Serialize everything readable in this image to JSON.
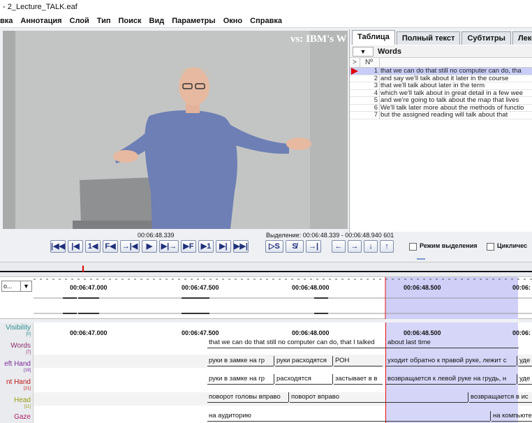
{
  "window": {
    "title": "- 2_Lecture_TALK.eaf"
  },
  "menu": [
    "вка",
    "Аннотация",
    "Слой",
    "Тип",
    "Поиск",
    "Вид",
    "Параметры",
    "Окно",
    "Справка"
  ],
  "video": {
    "watermark": "vs: IBM's W"
  },
  "right_panel": {
    "tabs": [
      "Таблица",
      "Полный текст",
      "Субтитры",
      "Лексик"
    ],
    "tier_dropdown": "▼",
    "tier_name": "Words",
    "col_marker": ">",
    "col_number": "Nº",
    "rows": [
      {
        "num": "1",
        "text": "that we can do that still no computer can do, tha"
      },
      {
        "num": "2",
        "text": "and say we'll talk about it later in the course"
      },
      {
        "num": "3",
        "text": "that we'll talk about later in the term"
      },
      {
        "num": "4",
        "text": "which we'll talk about in great detail in a few wee"
      },
      {
        "num": "5",
        "text": "and we're going to talk about the map that lives"
      },
      {
        "num": "6",
        "text": "We'll talk later more about the methods of functio"
      },
      {
        "num": "7",
        "text": "but the assigned reading will talk about that"
      }
    ]
  },
  "controls": {
    "current_time": "00:06:48.339",
    "selection": "Выделение: 00:06:48.339 - 00:06:48.940  601",
    "buttons": [
      "|◀◀",
      "|◀",
      "1◀",
      "F◀",
      "→|◀",
      "▶",
      "▶|→",
      "▶F",
      "▶1",
      "▶|",
      "▶▶|",
      "▷S",
      "S̸",
      "→|",
      "←",
      "→",
      "↓",
      "↑"
    ],
    "selection_mode": "Режим выделения",
    "loop_mode": "Цикличес"
  },
  "waveform": {
    "dropdown": "о...",
    "dropdown_arrow": "▼",
    "times": [
      "00:06:47.000",
      "00:06:47.500",
      "00:06:48.000",
      "00:06:48.500",
      "00:06:"
    ]
  },
  "timeline": {
    "times": [
      "00:06:47.000",
      "00:06:47.500",
      "00:06:48.000",
      "00:06:48.500",
      "00:06:"
    ],
    "tiers": [
      {
        "name": "Visibility",
        "count": "[0]",
        "color": "#2a8f8f"
      },
      {
        "name": "Words",
        "count": "[7]",
        "color": "#8b2d6b"
      },
      {
        "name": "eft Hand",
        "count": "[19]",
        "color": "#7a2a9a"
      },
      {
        "name": "nt Hand",
        "count": "[21]",
        "color": "#c01818"
      },
      {
        "name": "Head",
        "count": "[11]",
        "color": "#9a9a10"
      },
      {
        "name": "Gaze",
        "count": "",
        "color": "#b0206a"
      }
    ],
    "annotations": {
      "words": [
        "that we can do that still no computer can do, that I talked",
        "about last time"
      ],
      "left_hand": [
        "руки в замке на гр",
        "руки расходятся",
        "РОН",
        "уходит обратно к правой руке, лежит с",
        "уде"
      ],
      "right_hand": [
        "руки в замке на гр",
        "расходятся",
        "застывает в в",
        "возвращается к левой руке на грудь, н",
        "уде"
      ],
      "head": [
        "поворот головы вправо",
        "поворот вправо",
        "возвращается в ис"
      ],
      "gaze": [
        "на аудиторию",
        "на компьюте"
      ]
    }
  },
  "colors": {
    "selection": "#cfcff8",
    "cursor": "#e01010",
    "accent": "#1f2f7a"
  }
}
